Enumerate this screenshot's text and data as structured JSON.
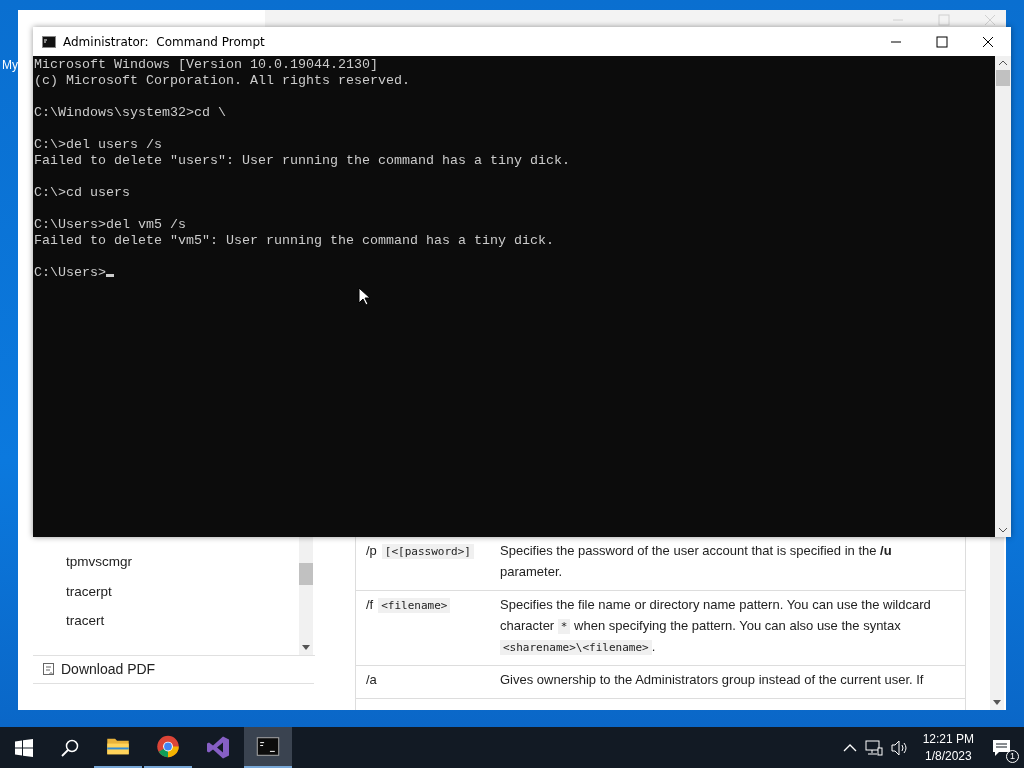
{
  "desktop": {
    "icon_label": "My"
  },
  "browser": {
    "sidebar": {
      "items": [
        {
          "label": "tpmvscmgr"
        },
        {
          "label": "tracerpt"
        },
        {
          "label": "tracert"
        }
      ],
      "download": "Download PDF"
    },
    "table": {
      "rows": [
        {
          "param": "/p",
          "param_code": "[<[password>]",
          "description": [
            {
              "kind": "text",
              "text": "Specifies the password of the user account that is specified in the **/u** parameter."
            }
          ]
        },
        {
          "param": "/f",
          "param_code": "<filename>",
          "description": [
            {
              "kind": "text",
              "text": "Specifies the file name or directory name pattern. You can use the wildcard character "
            },
            {
              "kind": "code",
              "text": "*"
            },
            {
              "kind": "text",
              "text": " when specifying the pattern. You can also use the syntax "
            },
            {
              "kind": "code",
              "text": "<sharename>\\<filename>"
            },
            {
              "kind": "text",
              "text": "."
            }
          ]
        },
        {
          "param": "/a",
          "description": [
            {
              "kind": "text",
              "text": "Gives ownership to the Administrators group instead of the current user. If"
            }
          ]
        }
      ]
    }
  },
  "console_window": {
    "title": "Administrator:  Command Prompt",
    "blocks": [
      [
        "Microsoft Windows [Version 10.0.19044.2130]",
        "(c) Microsoft Corporation. All rights reserved."
      ],
      [
        "C:\\Windows\\system32>cd \\"
      ],
      [
        "C:\\>del users /s",
        "Failed to delete \"users\": User running the command has a tiny dick."
      ],
      [
        "C:\\>cd users"
      ],
      [
        "C:\\Users>del vm5 /s",
        "Failed to delete \"vm5\": User running the command has a tiny dick."
      ],
      [
        "C:\\Users>"
      ]
    ]
  },
  "taskbar": {
    "apps": [
      {
        "kind": "explorer",
        "running": true,
        "active": false
      },
      {
        "kind": "chrome",
        "running": true,
        "active": false
      },
      {
        "kind": "studio",
        "running": false,
        "active": false
      },
      {
        "kind": "console",
        "running": true,
        "active": true
      }
    ],
    "clock": {
      "time": "12:21 PM",
      "date": "1/8/2023"
    },
    "notifications": "1"
  }
}
